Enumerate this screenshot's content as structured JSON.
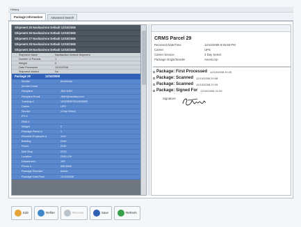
{
  "window": {
    "title": "History"
  },
  "tabs": [
    {
      "label": "Package Information",
      "active": true
    },
    {
      "label": "Advanced Search",
      "active": false
    }
  ],
  "shipments": [
    {
      "label": "Shipment 25 Navitas/Ann Default 12/10/2008"
    },
    {
      "label": "Shipment 26 Navitas/Ann Default 12/10/2008"
    },
    {
      "label": "Shipment 27 Navitas/Ann Default 12/10/2008"
    },
    {
      "label": "Shipment 28 Navitas/Ann Default 12/10/2008"
    },
    {
      "label": "Shipment 29 Navitas/Ann Default 12/10/2008"
    }
  ],
  "shipment_props": [
    {
      "key": "Shipment Name",
      "value": "Navitas/Ann Default Shipment"
    },
    {
      "key": "Number of Parcels",
      "value": "1"
    },
    {
      "key": "Weight",
      "value": "0"
    },
    {
      "key": "Date Processed",
      "value": "12/10/2008"
    },
    {
      "key": "Shipment Voided",
      "value": "No"
    }
  ],
  "package_row": {
    "label": "Package 29",
    "date": "12/10/2008"
  },
  "package_details": [
    {
      "key": "Sender",
      "value": "Americorp"
    },
    {
      "key": "Sender Email",
      "value": ""
    },
    {
      "key": "Recipient",
      "value": "JIM HUNT"
    },
    {
      "key": "Recipient Email",
      "value": "JIMH@navitasi.com"
    },
    {
      "key": "Tracking #",
      "value": "1Z025E8F0312345689"
    },
    {
      "key": "Carrier",
      "value": "UPS"
    },
    {
      "key": "Service",
      "value": "3 Day Select"
    },
    {
      "key": "PO #",
      "value": ""
    },
    {
      "key": "RMA #",
      "value": ""
    },
    {
      "key": "Weight",
      "value": "0"
    },
    {
      "key": "Package Parcel #",
      "value": "1"
    },
    {
      "key": "Receiver Employee #",
      "value": "1101"
    },
    {
      "key": "Building",
      "value": "2345"
    },
    {
      "key": "Room",
      "value": "2345"
    },
    {
      "key": "Mail Stop",
      "value": "2233"
    },
    {
      "key": "Location",
      "value": "2345-129"
    },
    {
      "key": "Department",
      "value": "129"
    },
    {
      "key": "Phone #",
      "value": "555-6000"
    },
    {
      "key": "Package Receiver",
      "value": "Admin"
    },
    {
      "key": "Package Date/Time",
      "value": "12/10/2008"
    }
  ],
  "detail": {
    "title": "CRMS Parcel 29",
    "info": [
      {
        "key": "Received Date/Time",
        "value": "12/10/2008 8:25:59 PM"
      },
      {
        "key": "Carrier",
        "value": "UPS"
      },
      {
        "key": "Carrier Service",
        "value": "3 Day Select"
      },
      {
        "key": "Package Origin/Sender",
        "value": "Americorp"
      }
    ],
    "events": [
      {
        "name": "Package: First Processed",
        "date": "12/10/2008 20:25"
      },
      {
        "name": "Package: Scanned",
        "date": "12/10/2008 20:58"
      },
      {
        "name": "Package: Scanned",
        "date": "12/10/2008 21:09"
      },
      {
        "name": "Package: Signed For",
        "date": "12/10/2008 21:09"
      }
    ],
    "signature_label": "Signature"
  },
  "toolbar": [
    {
      "label": "Edit",
      "icon": "edit-icon",
      "color": "#e3a23a",
      "enabled": true
    },
    {
      "label": "Refiler",
      "icon": "refile-icon",
      "color": "#3e86c9",
      "enabled": true
    },
    {
      "label": "Recover",
      "icon": "recover-icon",
      "color": "#b8c3cc",
      "enabled": false
    },
    {
      "label": "Save",
      "icon": "save-icon",
      "color": "#2f5fb3",
      "enabled": true
    },
    {
      "label": "Refresh",
      "icon": "refresh-icon",
      "color": "#3a9f4a",
      "enabled": true
    }
  ]
}
